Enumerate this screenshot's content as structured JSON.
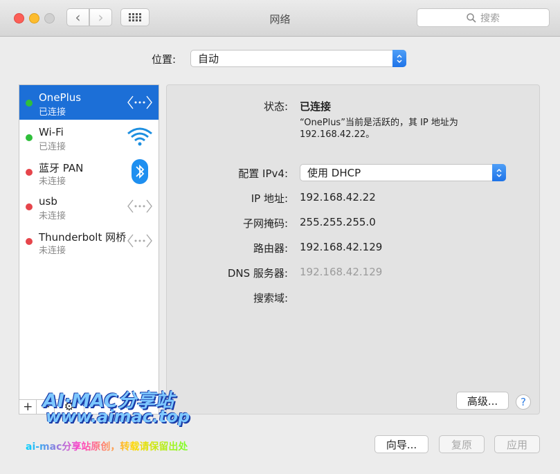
{
  "window": {
    "title": "网络"
  },
  "search": {
    "placeholder": "搜索",
    "icon": "search-icon"
  },
  "location": {
    "label": "位置:",
    "value": "自动"
  },
  "services": [
    {
      "name": "OnePlus",
      "status": "已连接",
      "status_color": "green",
      "icon": "ethernet-arrows-icon",
      "selected": true
    },
    {
      "name": "Wi-Fi",
      "status": "已连接",
      "status_color": "green",
      "icon": "wifi-icon",
      "selected": false
    },
    {
      "name": "蓝牙 PAN",
      "status": "未连接",
      "status_color": "red",
      "icon": "bluetooth-icon",
      "selected": false
    },
    {
      "name": "usb",
      "status": "未连接",
      "status_color": "red",
      "icon": "ethernet-arrows-icon",
      "selected": false
    },
    {
      "name": "Thunderbolt 网桥",
      "status": "未连接",
      "status_color": "red",
      "icon": "ethernet-arrows-icon",
      "selected": false
    }
  ],
  "sidebar_tools": {
    "add": "+",
    "remove": "−",
    "gear": "⚙"
  },
  "detail": {
    "status_label": "状态:",
    "status_value": "已连接",
    "status_desc": "“OnePlus”当前是活跃的，其 IP 地址为 192.168.42.22。",
    "ipv4_label": "配置 IPv4:",
    "ipv4_value": "使用 DHCP",
    "ip_label": "IP 地址:",
    "ip_value": "192.168.42.22",
    "mask_label": "子网掩码:",
    "mask_value": "255.255.255.0",
    "router_label": "路由器:",
    "router_value": "192.168.42.129",
    "dns_label": "DNS 服务器:",
    "dns_value": "192.168.42.129",
    "domain_label": "搜索域:"
  },
  "buttons": {
    "advanced": "高级...",
    "help": "?",
    "assistant": "向导...",
    "revert": "复原",
    "apply": "应用"
  },
  "watermark": {
    "line1": "AI·MAC分享站",
    "line2": "www.aimac.top",
    "line3": "ai-mac分享站原创，转载请保留出处"
  },
  "colors": {
    "accent": "#1c6fd7",
    "connected": "#2fbf3b",
    "disconnected": "#e6454b"
  }
}
